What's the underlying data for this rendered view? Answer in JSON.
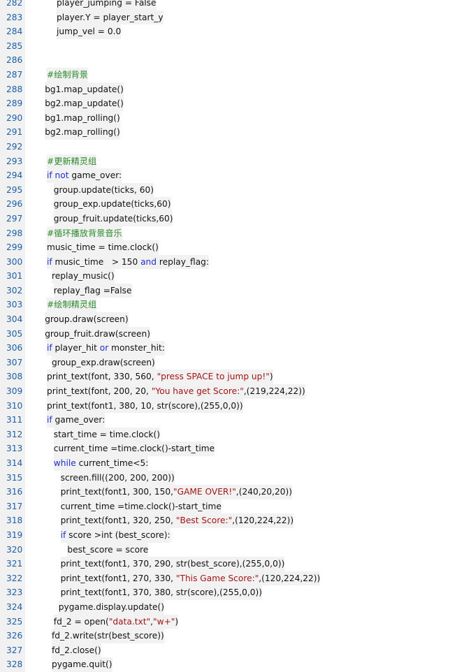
{
  "editor": {
    "colors": {
      "comment": "#2c8a2c",
      "keyword": "#1e2ecf",
      "string": "#a31515",
      "text": "#111111",
      "line_number": "#1c5ea8",
      "gutter": "#f1f1f1",
      "line_highlight": "#f2f2f2"
    },
    "lines": [
      {
        "n": "282",
        "indent": 6,
        "segs": [
          {
            "t": "tx",
            "v": "player_jumping = False"
          }
        ]
      },
      {
        "n": "283",
        "indent": 6,
        "segs": [
          {
            "t": "tx",
            "v": "player.Y = player_start_y"
          }
        ]
      },
      {
        "n": "284",
        "indent": 6,
        "segs": [
          {
            "t": "tx",
            "v": "jump_vel = 0.0"
          }
        ]
      },
      {
        "n": "285",
        "indent": 0,
        "segs": []
      },
      {
        "n": "286",
        "indent": 0,
        "segs": []
      },
      {
        "n": "287",
        "indent": 4,
        "segs": [
          {
            "t": "cm",
            "v": "#绘制背景"
          }
        ]
      },
      {
        "n": "288",
        "indent": 3.6,
        "segs": [
          {
            "t": "tx",
            "v": "bg1.map_update()"
          }
        ]
      },
      {
        "n": "289",
        "indent": 3.6,
        "segs": [
          {
            "t": "tx",
            "v": "bg2.map_update()"
          }
        ]
      },
      {
        "n": "290",
        "indent": 3.6,
        "segs": [
          {
            "t": "tx",
            "v": "bg1.map_rolling()"
          }
        ]
      },
      {
        "n": "291",
        "indent": 3.6,
        "segs": [
          {
            "t": "tx",
            "v": "bg2.map_rolling()"
          }
        ]
      },
      {
        "n": "292",
        "indent": 0,
        "segs": []
      },
      {
        "n": "293",
        "indent": 4,
        "segs": [
          {
            "t": "cm",
            "v": "#更新精灵组"
          }
        ]
      },
      {
        "n": "294",
        "indent": 4,
        "segs": [
          {
            "t": "kw",
            "v": "if not"
          },
          {
            "t": "tx",
            "v": " game_over:"
          }
        ]
      },
      {
        "n": "295",
        "indent": 5.4,
        "segs": [
          {
            "t": "tx",
            "v": "group.update(ticks, 60)"
          }
        ]
      },
      {
        "n": "296",
        "indent": 5.4,
        "segs": [
          {
            "t": "tx",
            "v": "group_exp.update(ticks,60)"
          }
        ]
      },
      {
        "n": "297",
        "indent": 5.4,
        "segs": [
          {
            "t": "tx",
            "v": "group_fruit.update(ticks,60)"
          }
        ]
      },
      {
        "n": "298",
        "indent": 4,
        "segs": [
          {
            "t": "cm",
            "v": "#循环播放背景音乐"
          }
        ]
      },
      {
        "n": "299",
        "indent": 4,
        "segs": [
          {
            "t": "tx",
            "v": "music_time = time.clock()"
          }
        ]
      },
      {
        "n": "300",
        "indent": 4,
        "segs": [
          {
            "t": "kw",
            "v": "if"
          },
          {
            "t": "tx",
            "v": " music_time   > 150 "
          },
          {
            "t": "kw",
            "v": "and"
          },
          {
            "t": "tx",
            "v": " replay_flag:"
          }
        ]
      },
      {
        "n": "301",
        "indent": 5,
        "segs": [
          {
            "t": "tx",
            "v": "replay_music()"
          }
        ]
      },
      {
        "n": "302",
        "indent": 5.4,
        "segs": [
          {
            "t": "tx",
            "v": "replay_flag =False"
          }
        ]
      },
      {
        "n": "303",
        "indent": 4,
        "segs": [
          {
            "t": "cm",
            "v": "#绘制精灵组"
          }
        ]
      },
      {
        "n": "304",
        "indent": 3.6,
        "segs": [
          {
            "t": "tx",
            "v": "group.draw(screen)"
          }
        ]
      },
      {
        "n": "305",
        "indent": 3.6,
        "segs": [
          {
            "t": "tx",
            "v": "group_fruit.draw(screen)"
          }
        ]
      },
      {
        "n": "306",
        "indent": 4,
        "segs": [
          {
            "t": "kw",
            "v": "if"
          },
          {
            "t": "tx",
            "v": " player_hit "
          },
          {
            "t": "kw",
            "v": "or"
          },
          {
            "t": "tx",
            "v": " monster_hit:"
          }
        ]
      },
      {
        "n": "307",
        "indent": 5,
        "segs": [
          {
            "t": "tx",
            "v": "group_exp.draw(screen)"
          }
        ]
      },
      {
        "n": "308",
        "indent": 4,
        "segs": [
          {
            "t": "tx",
            "v": "print_text(font, 330, 560, "
          },
          {
            "t": "st",
            "v": "\"press SPACE to jump up!\""
          },
          {
            "t": "tx",
            "v": ")"
          }
        ]
      },
      {
        "n": "309",
        "indent": 4,
        "segs": [
          {
            "t": "tx",
            "v": "print_text(font, 200, 20, "
          },
          {
            "t": "st",
            "v": "\"You have get Score:\""
          },
          {
            "t": "tx",
            "v": ",(219,224,22))"
          }
        ]
      },
      {
        "n": "310",
        "indent": 4,
        "segs": [
          {
            "t": "tx",
            "v": "print_text(font1, 380, 10, str(score),(255,0,0))"
          }
        ]
      },
      {
        "n": "311",
        "indent": 4,
        "segs": [
          {
            "t": "kw",
            "v": "if"
          },
          {
            "t": "tx",
            "v": " game_over:"
          }
        ]
      },
      {
        "n": "312",
        "indent": 5.4,
        "segs": [
          {
            "t": "tx",
            "v": "start_time = time.clock()"
          }
        ]
      },
      {
        "n": "313",
        "indent": 5.4,
        "segs": [
          {
            "t": "tx",
            "v": "current_time =time.clock()-start_time"
          }
        ]
      },
      {
        "n": "314",
        "indent": 5.4,
        "segs": [
          {
            "t": "kw",
            "v": "while"
          },
          {
            "t": "tx",
            "v": " current_time<5:"
          }
        ]
      },
      {
        "n": "315",
        "indent": 6.8,
        "segs": [
          {
            "t": "tx",
            "v": "screen.fill((200, 200, 200))"
          }
        ]
      },
      {
        "n": "316",
        "indent": 6.8,
        "segs": [
          {
            "t": "tx",
            "v": "print_text(font1, 300, 150,"
          },
          {
            "t": "st",
            "v": "\"GAME OVER!\""
          },
          {
            "t": "tx",
            "v": ",(240,20,20))"
          }
        ]
      },
      {
        "n": "317",
        "indent": 6.8,
        "segs": [
          {
            "t": "tx",
            "v": "current_time =time.clock()-start_time"
          }
        ]
      },
      {
        "n": "318",
        "indent": 6.8,
        "segs": [
          {
            "t": "tx",
            "v": "print_text(font1, 320, 250, "
          },
          {
            "t": "st",
            "v": "\"Best Score:\""
          },
          {
            "t": "tx",
            "v": ",(120,224,22))"
          }
        ]
      },
      {
        "n": "319",
        "indent": 6.8,
        "segs": [
          {
            "t": "kw",
            "v": "if"
          },
          {
            "t": "tx",
            "v": " score >int (best_score):"
          }
        ]
      },
      {
        "n": "320",
        "indent": 8.2,
        "segs": [
          {
            "t": "tx",
            "v": "best_score = score"
          }
        ]
      },
      {
        "n": "321",
        "indent": 6.8,
        "segs": [
          {
            "t": "tx",
            "v": "print_text(font1, 370, 290, str(best_score),(255,0,0))"
          }
        ]
      },
      {
        "n": "322",
        "indent": 6.8,
        "segs": [
          {
            "t": "tx",
            "v": "print_text(font1, 270, 330, "
          },
          {
            "t": "st",
            "v": "\"This Game Score:\""
          },
          {
            "t": "tx",
            "v": ",(120,224,22))"
          }
        ]
      },
      {
        "n": "323",
        "indent": 6.8,
        "segs": [
          {
            "t": "tx",
            "v": "print_text(font1, 370, 380, str(score),(255,0,0))"
          }
        ]
      },
      {
        "n": "324",
        "indent": 6.4,
        "segs": [
          {
            "t": "tx",
            "v": "pygame.display.update()"
          }
        ]
      },
      {
        "n": "325",
        "indent": 5.4,
        "segs": [
          {
            "t": "tx",
            "v": "fd_2 = open("
          },
          {
            "t": "st",
            "v": "\"data.txt\""
          },
          {
            "t": "tx",
            "v": ","
          },
          {
            "t": "st",
            "v": "\"w+\""
          },
          {
            "t": "tx",
            "v": ")"
          }
        ]
      },
      {
        "n": "326",
        "indent": 5,
        "segs": [
          {
            "t": "tx",
            "v": "fd_2.write(str(best_score))"
          }
        ]
      },
      {
        "n": "327",
        "indent": 5,
        "segs": [
          {
            "t": "tx",
            "v": "fd_2.close()"
          }
        ]
      },
      {
        "n": "328",
        "indent": 5,
        "segs": [
          {
            "t": "tx",
            "v": "pygame.quit()"
          }
        ]
      }
    ]
  }
}
